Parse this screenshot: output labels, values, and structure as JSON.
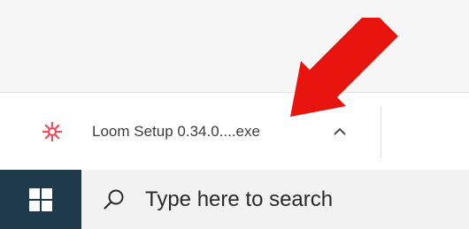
{
  "download_bar": {
    "file_name": "Loom Setup 0.34.0....exe",
    "icon": "loom-logo-icon",
    "chevron_icon": "chevron-up-icon"
  },
  "taskbar": {
    "start_icon": "windows-logo-icon",
    "search_icon": "search-icon",
    "search_placeholder": "Type here to search"
  },
  "annotation": {
    "arrow_icon": "red-arrow-icon",
    "arrow_color": "#e8150f"
  },
  "colors": {
    "taskbar": "#1e3a4b",
    "search_box": "#f2f2f2",
    "loom_brand": "#e8525f"
  }
}
